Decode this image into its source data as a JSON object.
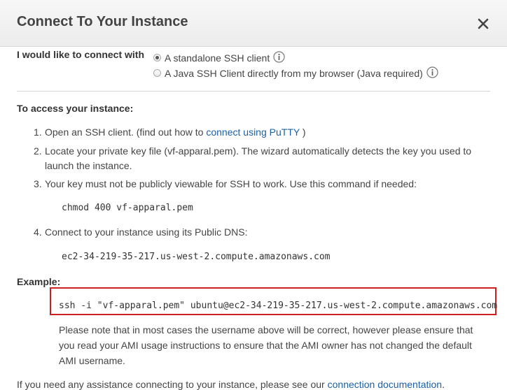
{
  "dialog": {
    "title": "Connect To Your Instance"
  },
  "connect_with": {
    "label": "I would like to connect with",
    "options": [
      {
        "label": "A standalone SSH client",
        "selected": true
      },
      {
        "label": "A Java SSH Client directly from my browser (Java required)",
        "selected": false
      }
    ]
  },
  "access": {
    "heading": "To access your instance:",
    "steps": [
      {
        "num": "1.",
        "text": "Open an SSH client. (find out how to",
        "link": "connect using PuTTY",
        "after": ")"
      },
      {
        "num": "2.",
        "line1": "Locate your private key file (vf-apparal.pem). The wizard automatically detects the key you used to",
        "line2": "launch the instance."
      },
      {
        "num": "3.",
        "text": "Your key must not be publicly viewable for SSH to work. Use this command if needed:",
        "code": "chmod 400 vf-apparal.pem"
      },
      {
        "num": "4.",
        "text": "Connect to your instance using its Public DNS:",
        "code": "ec2-34-219-35-217.us-west-2.compute.amazonaws.com"
      }
    ]
  },
  "example": {
    "heading": "Example:",
    "command": "ssh -i \"vf-apparal.pem\" ubuntu@ec2-34-219-35-217.us-west-2.compute.amazonaws.com",
    "note_lines": [
      "Please note that in most cases the username above will be correct, however please ensure that",
      "you read your AMI usage instructions to ensure that the AMI owner has not changed the default",
      "AMI username."
    ]
  },
  "footer": {
    "text": "If you need any assistance connecting to your instance, please see our",
    "link": "connection documentation",
    "after": "."
  },
  "colors": {
    "link": "#1a5fa8",
    "highlight_border": "#cc1f1f"
  }
}
